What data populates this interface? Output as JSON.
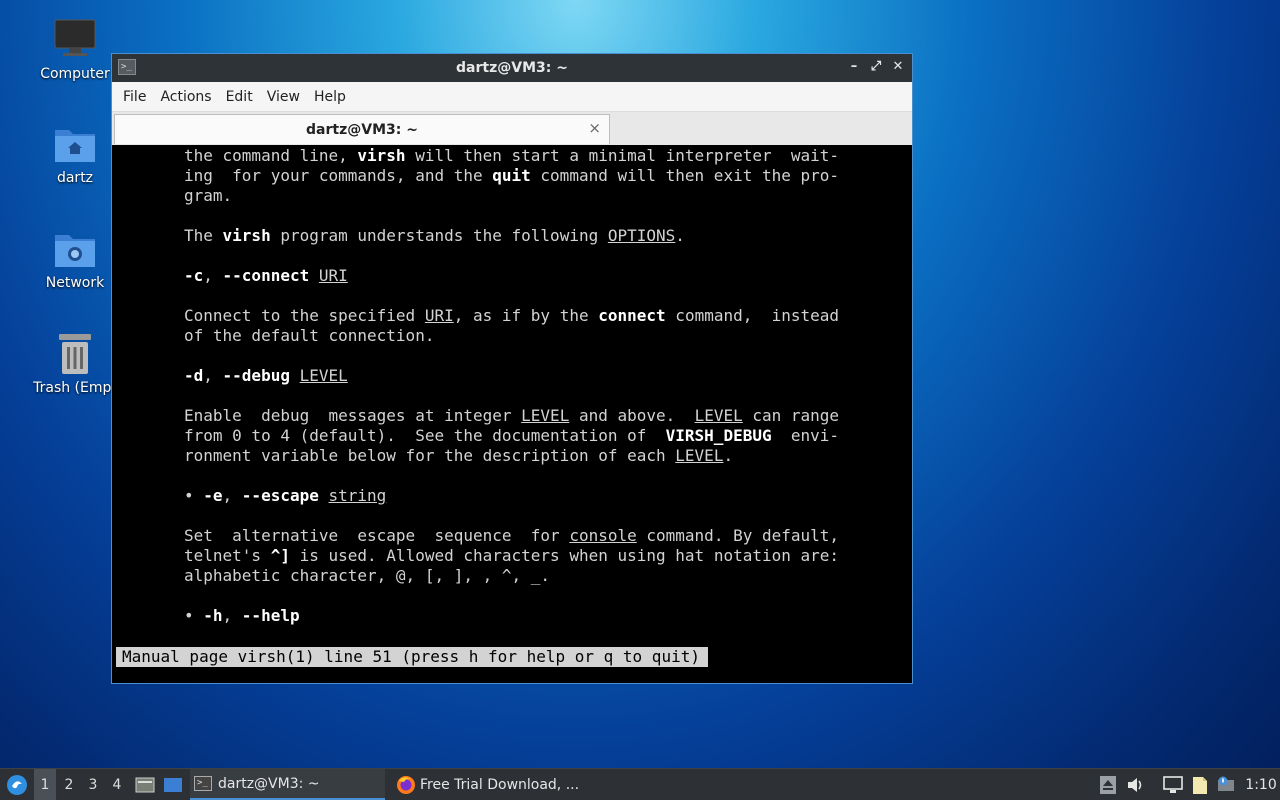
{
  "desktop": {
    "icons": [
      {
        "label": "Computer"
      },
      {
        "label": "dartz"
      },
      {
        "label": "Network"
      },
      {
        "label": "Trash (Empt"
      }
    ]
  },
  "window": {
    "title": "dartz@VM3: ~",
    "menu": [
      "File",
      "Actions",
      "Edit",
      "View",
      "Help"
    ],
    "tab_label": "dartz@VM3: ~",
    "close_glyph": "×"
  },
  "terminal": {
    "status": "Manual page virsh(1) line 51 (press h for help or q to quit)"
  },
  "taskbar": {
    "workspaces": [
      "1",
      "2",
      "3",
      "4"
    ],
    "tasks": [
      {
        "label": "dartz@VM3: ~"
      },
      {
        "label": "Free Trial Download, ..."
      }
    ],
    "clock": "1:10"
  }
}
